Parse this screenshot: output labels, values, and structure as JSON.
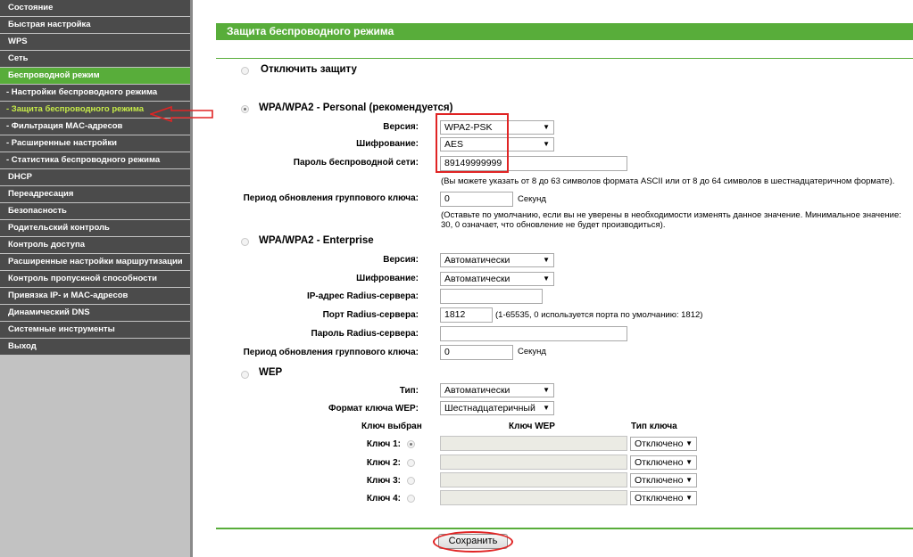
{
  "sidebar": {
    "items": [
      {
        "label": "Состояние",
        "state": "normal"
      },
      {
        "label": "Быстрая настройка",
        "state": "normal"
      },
      {
        "label": "WPS",
        "state": "normal"
      },
      {
        "label": "Сеть",
        "state": "normal"
      },
      {
        "label": "Беспроводной режим",
        "state": "active"
      },
      {
        "label": "- Настройки беспроводного режима",
        "state": "sub"
      },
      {
        "label": "- Защита беспроводного режима",
        "state": "sub-current"
      },
      {
        "label": "- Фильтрация MAC-адресов",
        "state": "sub"
      },
      {
        "label": "- Расширенные настройки",
        "state": "sub"
      },
      {
        "label": "- Статистика беспроводного режима",
        "state": "sub"
      },
      {
        "label": "DHCP",
        "state": "normal"
      },
      {
        "label": "Переадресация",
        "state": "normal"
      },
      {
        "label": "Безопасность",
        "state": "normal"
      },
      {
        "label": "Родительский контроль",
        "state": "normal"
      },
      {
        "label": "Контроль доступа",
        "state": "normal"
      },
      {
        "label": "Расширенные настройки маршрутизации",
        "state": "normal"
      },
      {
        "label": "Контроль пропускной способности",
        "state": "normal"
      },
      {
        "label": "Привязка IP- и MAC-адресов",
        "state": "normal"
      },
      {
        "label": "Динамический DNS",
        "state": "normal"
      },
      {
        "label": "Системные инструменты",
        "state": "normal"
      },
      {
        "label": "Выход",
        "state": "normal"
      }
    ]
  },
  "page": {
    "title": "Защита беспроводного режима"
  },
  "disable": {
    "label": "Отключить защиту",
    "checked": false
  },
  "personal": {
    "title": "WPA/WPA2 - Personal (рекомендуется)",
    "checked": true,
    "version_label": "Версия:",
    "version_value": "WPA2-PSK",
    "encryption_label": "Шифрование:",
    "encryption_value": "AES",
    "password_label": "Пароль беспроводной сети:",
    "password_value": "89149999999",
    "password_note": "(Вы можете указать от 8 до 63 символов формата ASCII или от 8 до 64 символов в шестнадцатеричном формате).",
    "group_key_label": "Период обновления группового ключа:",
    "group_key_value": "0",
    "group_key_unit": "Секунд",
    "group_key_note_1": "(Оставьте по умолчанию, если вы не уверены в необходимости изменять данное значение. Минимальное значение:",
    "group_key_note_2": "30, 0 означает, что обновление не будет производиться)."
  },
  "enterprise": {
    "title": "WPA/WPA2 - Enterprise",
    "checked": false,
    "version_label": "Версия:",
    "version_value": "Автоматически",
    "encryption_label": "Шифрование:",
    "encryption_value": "Автоматически",
    "radius_ip_label": "IP-адрес Radius-сервера:",
    "radius_ip_value": "",
    "radius_port_label": "Порт Radius-сервера:",
    "radius_port_value": "1812",
    "radius_port_note": "(1-65535, 0 используется порта по умолчанию: 1812)",
    "radius_password_label": "Пароль Radius-сервера:",
    "radius_password_value": "",
    "group_key_label": "Период обновления группового ключа:",
    "group_key_value": "0",
    "group_key_unit": "Секунд"
  },
  "wep": {
    "title": "WEP",
    "checked": false,
    "type_label": "Тип:",
    "type_value": "Автоматически",
    "format_label": "Формат ключа WEP:",
    "format_value": "Шестнадцатеричный",
    "col_selected": "Ключ выбран",
    "col_key": "Ключ WEP",
    "col_type": "Тип ключа",
    "keys": [
      {
        "label": "Ключ 1:",
        "checked": true,
        "value": "",
        "type": "Отключено"
      },
      {
        "label": "Ключ 2:",
        "checked": false,
        "value": "",
        "type": "Отключено"
      },
      {
        "label": "Ключ 3:",
        "checked": false,
        "value": "",
        "type": "Отключено"
      },
      {
        "label": "Ключ 4:",
        "checked": false,
        "value": "",
        "type": "Отключено"
      }
    ]
  },
  "actions": {
    "save_label": "Сохранить"
  },
  "colors": {
    "accent": "#58ad3a",
    "nav_bg": "#4b4b4b",
    "current_sub": "#c7ec4a",
    "highlight": "#e02424"
  },
  "icons": {
    "dropdown": "chevron-down-icon",
    "pointer": "red-arrow-icon"
  }
}
